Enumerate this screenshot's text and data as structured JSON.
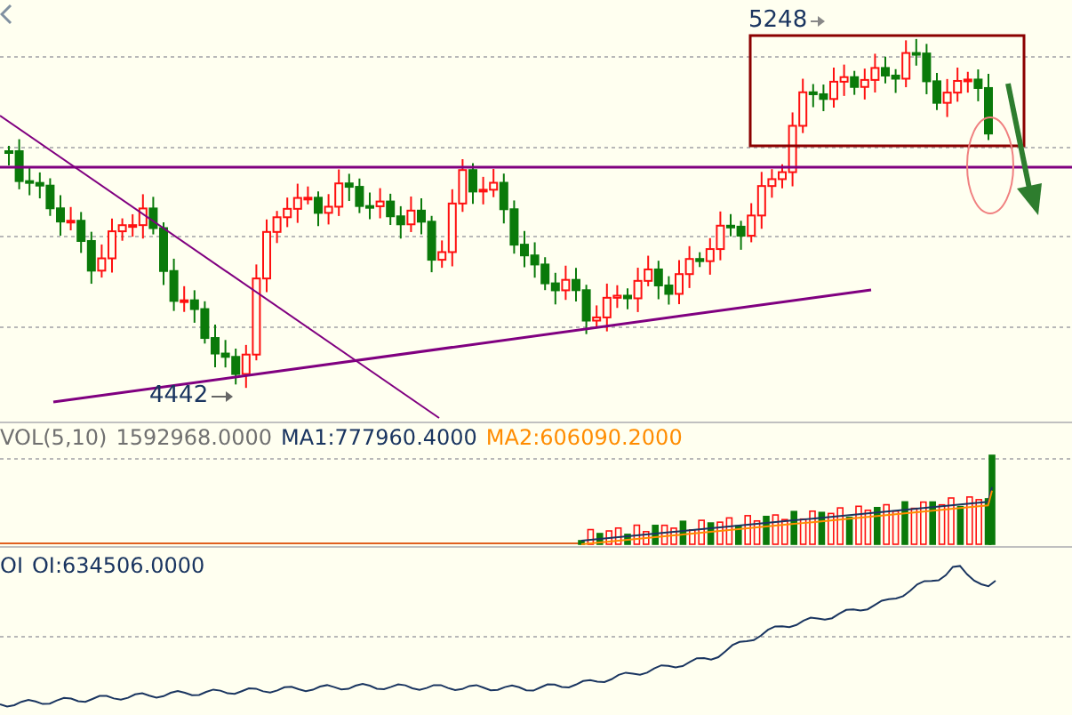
{
  "main_chart": {
    "annotations": [
      {
        "kind": "high",
        "text": "5248"
      },
      {
        "kind": "low",
        "text": "4442"
      }
    ]
  },
  "volume_panel": {
    "label": "VOL(5,10)",
    "value": "1592968.0000",
    "ma1": "MA1:777960.4000",
    "ma2": "MA2:606090.2000"
  },
  "oi_panel": {
    "label": "OI",
    "value": "OI:634506.0000"
  }
}
